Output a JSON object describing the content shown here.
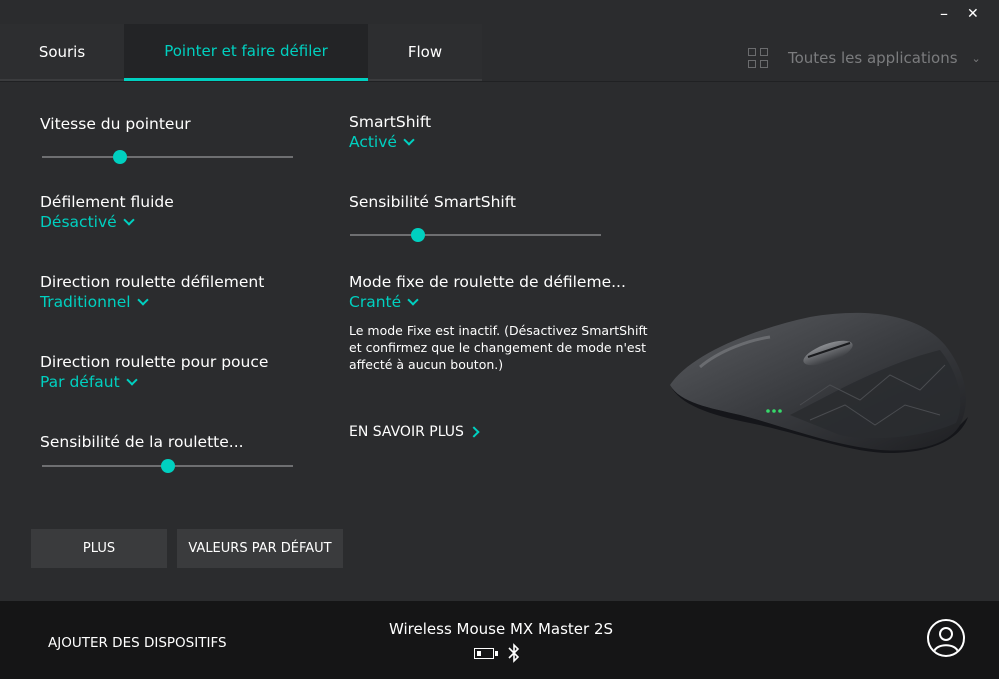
{
  "window": {
    "minimize": "–",
    "close": "✕"
  },
  "tabs": [
    {
      "label": "Souris"
    },
    {
      "label": "Pointer et faire défiler"
    },
    {
      "label": "Flow"
    }
  ],
  "apps": {
    "label": "Toutes les applications",
    "icon": "grid-icon"
  },
  "settings": {
    "pointer_speed": {
      "label": "Vitesse du pointeur",
      "level": 0.31
    },
    "smooth_scroll": {
      "label": "Défilement fluide",
      "value": "Désactivé"
    },
    "scroll_direction": {
      "label": "Direction roulette défilement",
      "value": "Traditionnel"
    },
    "thumb_direction": {
      "label": "Direction roulette pour pouce",
      "value": "Par défaut"
    },
    "wheel_sensitivity": {
      "label": "Sensibilité de la roulette...",
      "level": 0.5
    },
    "smartshift": {
      "label": "SmartShift",
      "value": "Activé"
    },
    "smartshift_sensitivity": {
      "label": "Sensibilité SmartShift",
      "level": 0.27
    },
    "fixed_mode": {
      "label": "Mode fixe de roulette de défileme...",
      "value": "Cranté"
    }
  },
  "info_text": "Le mode Fixe est inactif. (Désactivez SmartShift et confirmez que le changement de mode n'est affecté à aucun bouton.)",
  "learn_more": "EN SAVOIR PLUS",
  "buttons": {
    "more": "PLUS",
    "defaults": "VALEURS PAR DÉFAUT"
  },
  "footer": {
    "add_devices": "AJOUTER DES DISPOSITIFS",
    "device_name": "Wireless Mouse MX Master 2S",
    "icons": [
      "battery-icon",
      "bluetooth-icon",
      "account-icon"
    ]
  },
  "colors": {
    "accent": "#00d0c0",
    "background": "#2b2c2e",
    "footer": "#151516"
  }
}
